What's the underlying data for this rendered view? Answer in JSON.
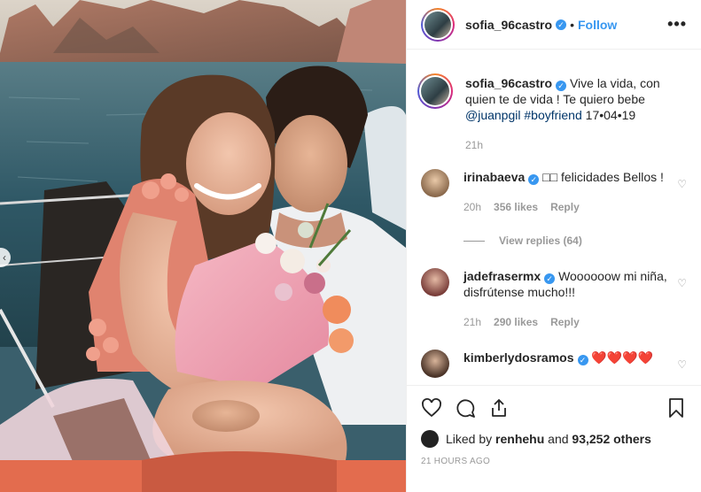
{
  "post": {
    "username": "sofia_96castro",
    "follow_label": "Follow",
    "separator": "•",
    "more_label": "•••"
  },
  "caption": {
    "username": "sofia_96castro",
    "text": "Vive la vida, con quien te de vida ! Te quiero bebe",
    "mention": "@juanpgil",
    "hashtag": "#boyfriend",
    "date": "17•04•19",
    "time": "21h"
  },
  "comments": [
    {
      "username": "irinabaeva",
      "text": "□□ felicidades Bellos !",
      "time": "20h",
      "likes": "356 likes",
      "reply_label": "Reply",
      "view_replies": "View replies (64)"
    },
    {
      "username": "jadefrasermx",
      "text": "Woooooow mi niña, disfrútense mucho!!!",
      "time": "21h",
      "likes": "290 likes",
      "reply_label": "Reply"
    },
    {
      "username": "kimberlydosramos",
      "text": "❤️❤️❤️❤️"
    }
  ],
  "likes_summary": {
    "prefix": "Liked by",
    "user": "renhehu",
    "and": "and",
    "others": "93,252 others"
  },
  "timestamp": "21 HOURS AGO",
  "icons": {
    "like": "heart-icon",
    "comment": "comment-icon",
    "share": "share-icon",
    "save": "bookmark-icon",
    "verified": "verified-badge-icon",
    "prev": "chevron-left-icon"
  },
  "colors": {
    "link_blue": "#3897f0",
    "mention": "#003569",
    "muted": "#999999",
    "text": "#262626"
  }
}
